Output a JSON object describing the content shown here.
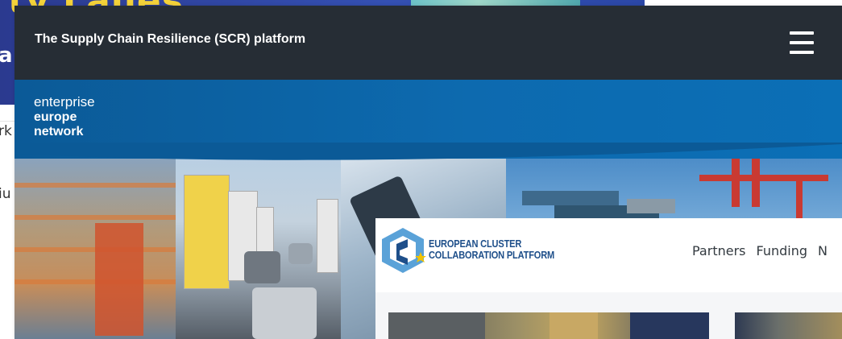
{
  "background_page": {
    "banner_title": "ty Lalles",
    "banner_subtitle": "a",
    "fragment_1": "rk",
    "fragment_2": "iu"
  },
  "scr_platform": {
    "title": "The Supply Chain Resilience (SCR) platform",
    "menu_icon": "hamburger-menu-icon",
    "logo": {
      "line1": "enterprise",
      "line2": "europe",
      "line3": "network"
    },
    "colors": {
      "header": "#262d35",
      "band": "#0b5a97"
    }
  },
  "eccp": {
    "logo_line1": "EUROPEAN CLUSTER",
    "logo_line2": "COLLABORATION PLATFORM",
    "nav": [
      "Partners",
      "Funding",
      "N"
    ],
    "colors": {
      "brand_blue": "#1e4f8a",
      "star": "#f2c300"
    }
  }
}
